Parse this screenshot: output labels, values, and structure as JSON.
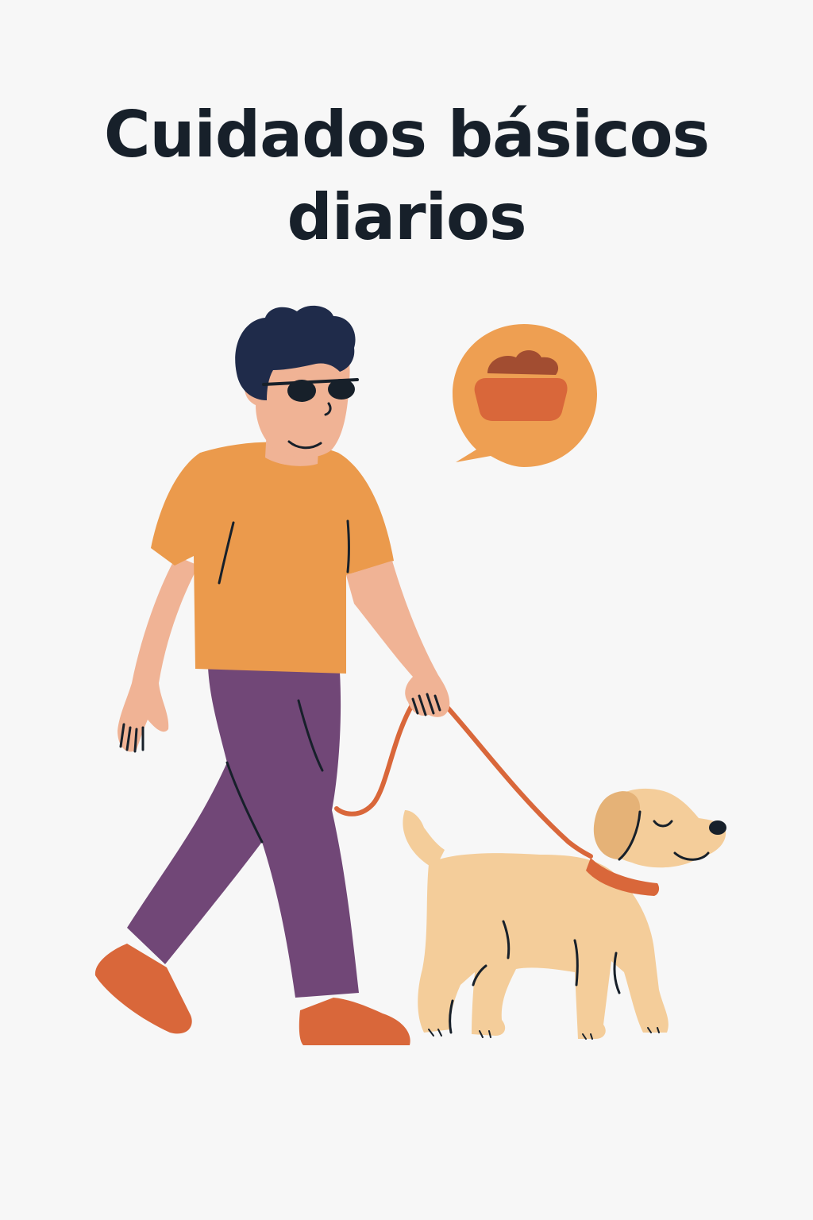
{
  "title": {
    "line1": "Cuidados básicos",
    "line2": "diarios"
  },
  "illustration": {
    "subjects": [
      "person-walking",
      "guide-dog",
      "leash",
      "food-bowl-speech-bubble"
    ],
    "icon": "food-bowl-icon"
  },
  "colors": {
    "background": "#f7f7f7",
    "title": "#17202a",
    "hair": "#1f2b4a",
    "skin": "#f0b395",
    "shirt": "#eb9a4c",
    "pants": "#714777",
    "shoes": "#d9673a",
    "leash": "#d9673a",
    "dog": "#f4cd9a",
    "dog_ear": "#e5b277",
    "bubble": "#ee9f52",
    "bowl": "#d9673a",
    "kibble": "#a24d31",
    "outline": "#17202a"
  }
}
